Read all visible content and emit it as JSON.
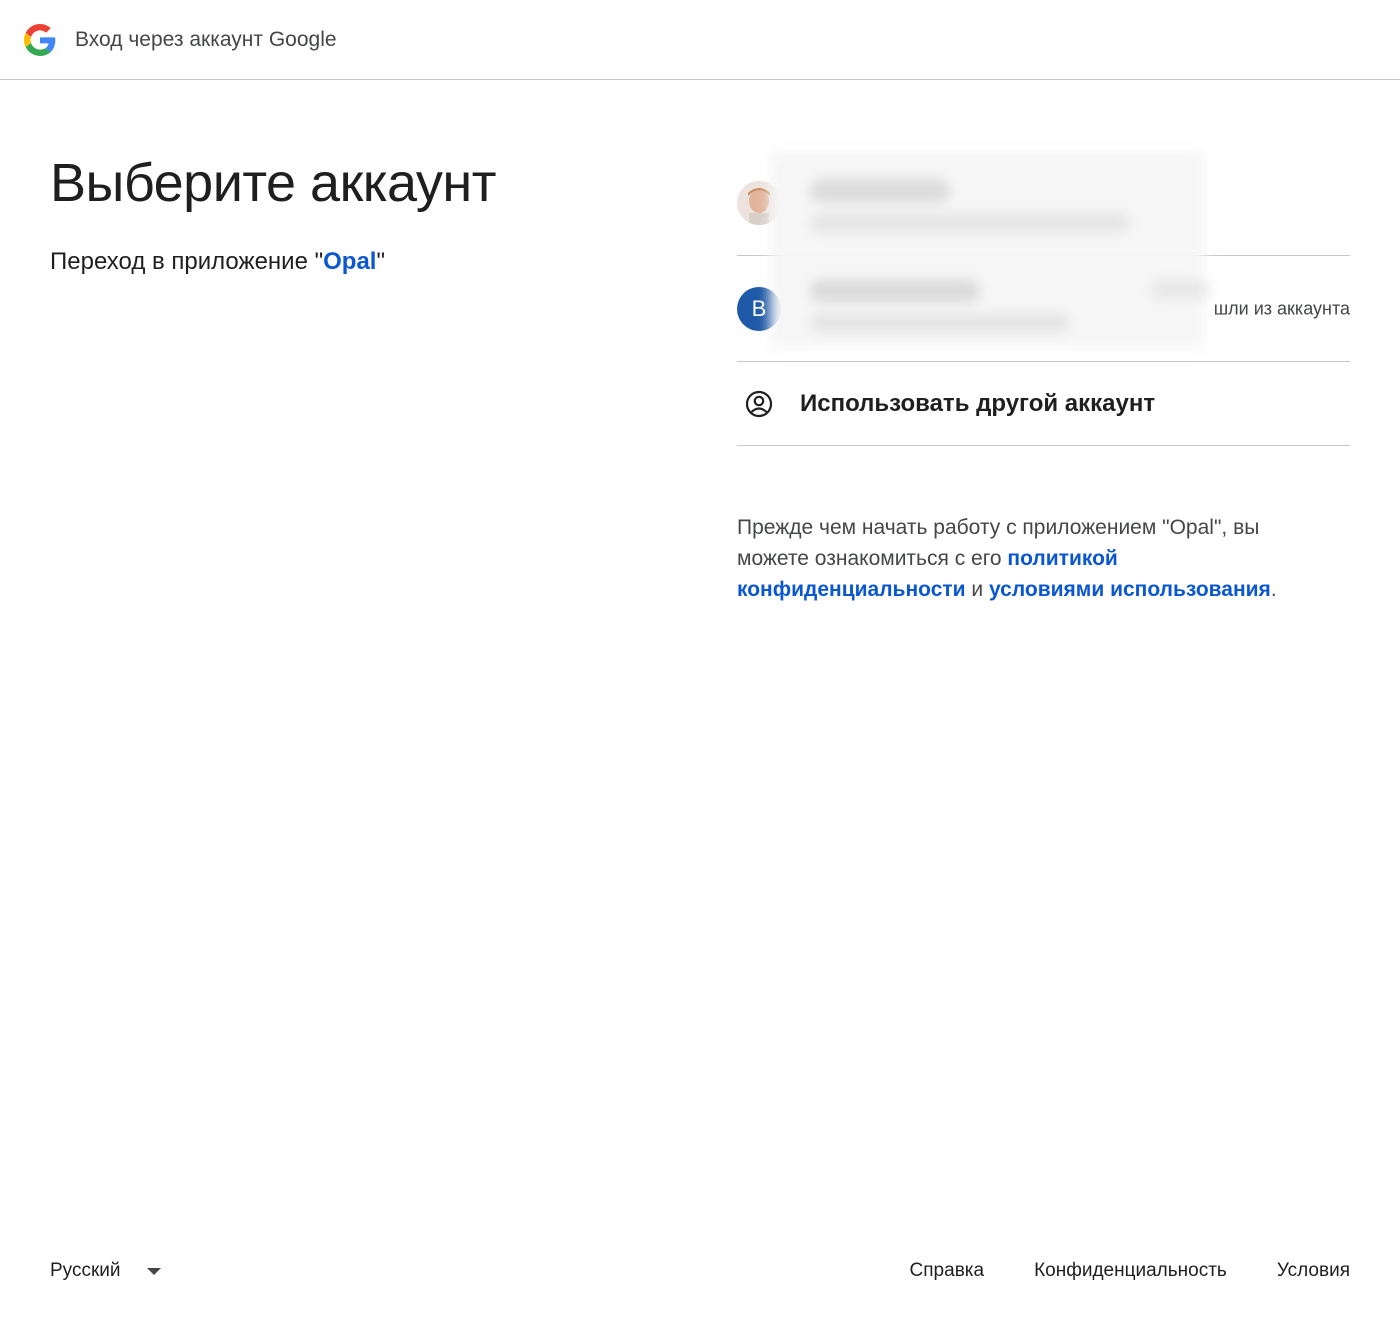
{
  "header": {
    "title": "Вход через аккаунт Google",
    "logo_icon": "google-g-icon"
  },
  "main": {
    "title": "Выберите аккаунт",
    "subtitle_prefix": "Переход в приложение \"",
    "app_name": "Opal",
    "subtitle_suffix": "\""
  },
  "accounts": [
    {
      "avatar": "photo"
    },
    {
      "avatar_letter": "В",
      "status": "шли из аккаунта"
    }
  ],
  "use_other": {
    "label": "Использовать другой аккаунт",
    "icon": "account-circle-icon"
  },
  "policy": {
    "text1": "Прежде чем начать работу с приложением \"Opal\", вы можете ознакомиться с его ",
    "privacy_link": "политикой конфиденциальности",
    "text2": " и ",
    "terms_link": "условиями использования",
    "text3": "."
  },
  "footer": {
    "language": "Русский",
    "links": [
      "Справка",
      "Конфиденциальность",
      "Условия"
    ]
  },
  "colors": {
    "link": "#0b57d0",
    "avatar_letter_bg": "#1f5aa8",
    "divider": "#c7c7c7"
  }
}
